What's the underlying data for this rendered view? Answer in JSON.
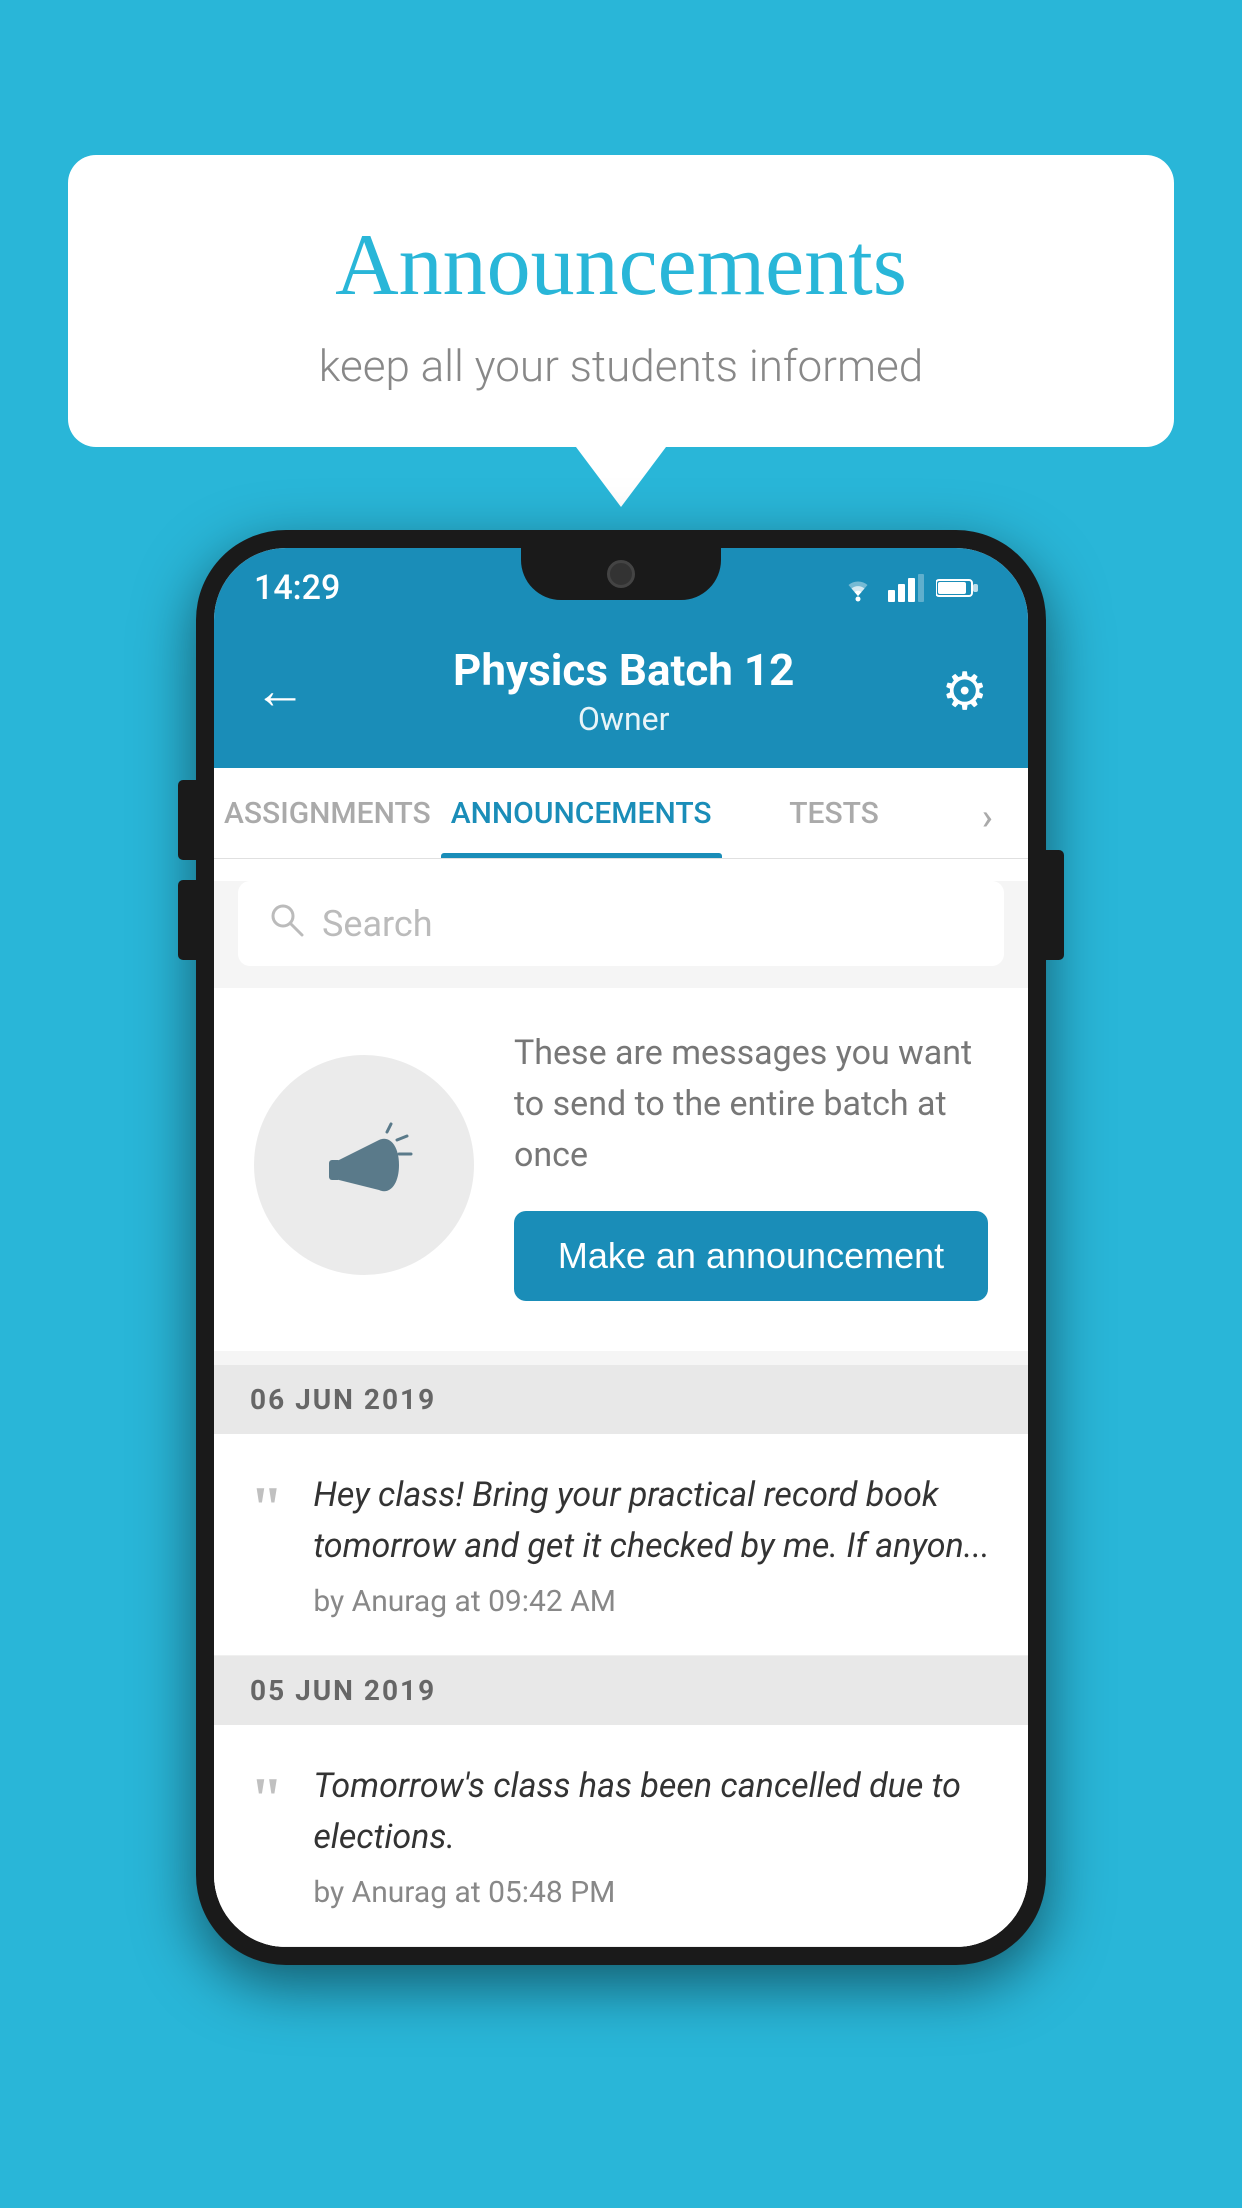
{
  "background_color": "#29B6D8",
  "speech_bubble": {
    "title": "Announcements",
    "subtitle": "keep all your students informed"
  },
  "phone": {
    "status_bar": {
      "time": "14:29",
      "icons": [
        "wifi",
        "signal",
        "battery"
      ]
    },
    "header": {
      "title": "Physics Batch 12",
      "subtitle": "Owner",
      "back_label": "←",
      "gear_label": "⚙"
    },
    "tabs": [
      {
        "label": "ASSIGNMENTS",
        "active": false
      },
      {
        "label": "ANNOUNCEMENTS",
        "active": true
      },
      {
        "label": "TESTS",
        "active": false
      },
      {
        "label": "›",
        "active": false
      }
    ],
    "search": {
      "placeholder": "Search"
    },
    "promo": {
      "description": "These are messages you want to send to the entire batch at once",
      "button_label": "Make an announcement"
    },
    "announcements": [
      {
        "date": "06  JUN  2019",
        "text": "Hey class! Bring your practical record book tomorrow and get it checked by me. If anyon...",
        "author": "by Anurag at 09:42 AM"
      },
      {
        "date": "05  JUN  2019",
        "text": "Tomorrow's class has been cancelled due to elections.",
        "author": "by Anurag at 05:48 PM"
      }
    ]
  }
}
